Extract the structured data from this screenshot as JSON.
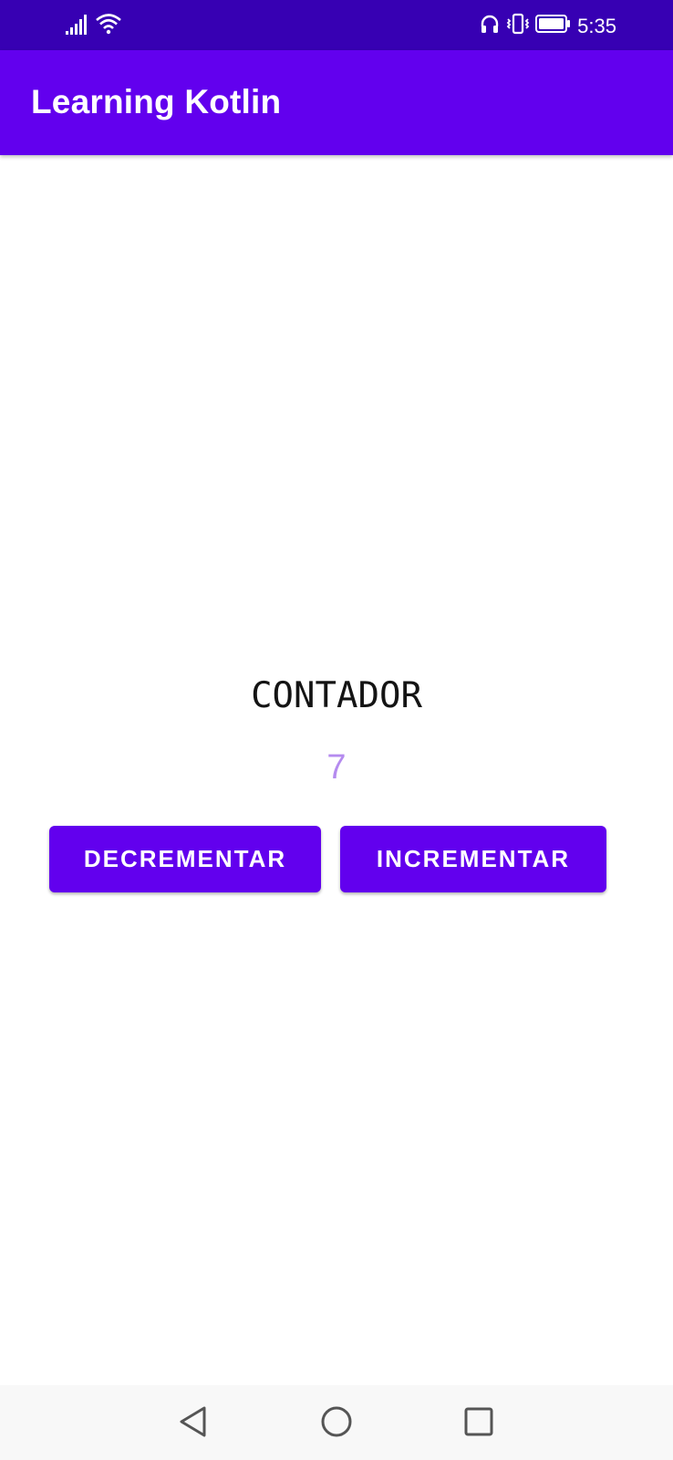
{
  "status_bar": {
    "time": "5:35",
    "icons": [
      "signal-icon",
      "wifi-icon",
      "headphones-icon",
      "vibrate-icon",
      "battery-icon"
    ],
    "background": "#3700B3"
  },
  "app_bar": {
    "title": "Learning Kotlin",
    "background": "#6200EE"
  },
  "main": {
    "counter_label": "CONTADOR",
    "counter_value": "7",
    "counter_value_color": "#B58BEF",
    "decrement_label": "DECREMENTAR",
    "increment_label": "INCREMENTAR",
    "button_color": "#6200EE"
  },
  "nav_bar": {
    "icons": [
      "back-icon",
      "home-icon",
      "recents-icon"
    ]
  }
}
